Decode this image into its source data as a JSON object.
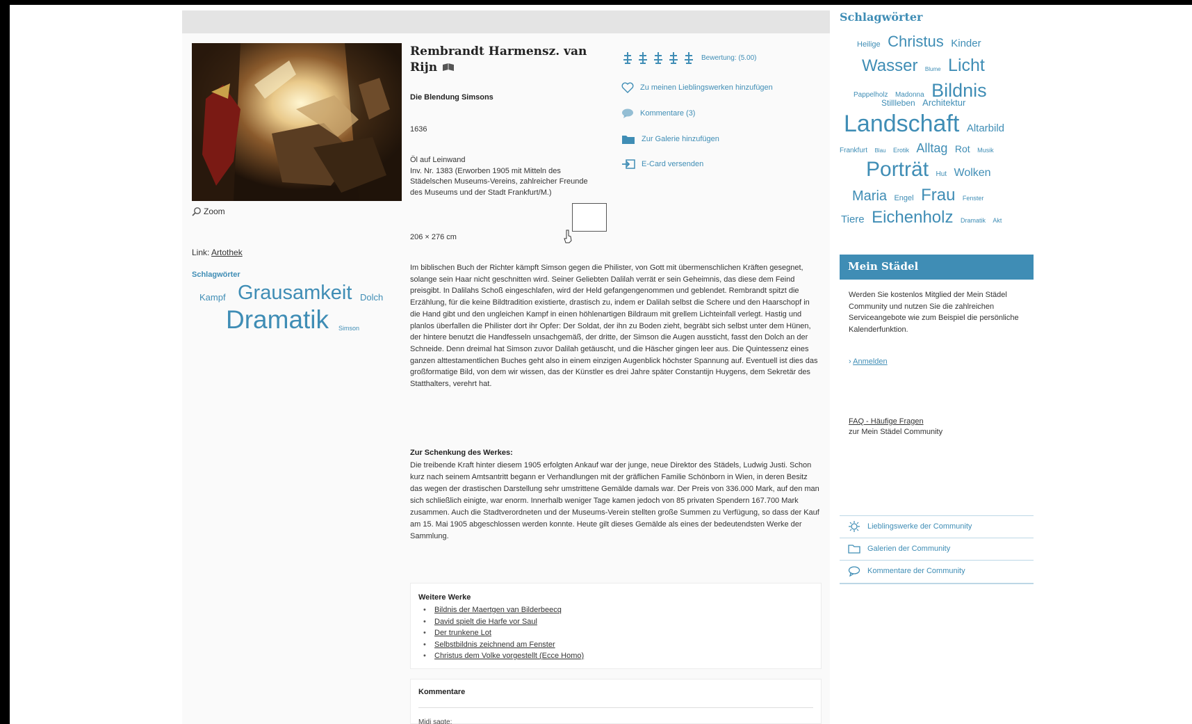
{
  "artwork": {
    "artist": "Rembrandt Harmensz. van Rijn",
    "title": "Die Blendung Simsons",
    "year": "1636",
    "medium": "Öl auf Leinwand",
    "inventory": "Inv. Nr. 1383 (Erworben 1905 mit Mitteln des Städelschen Museums-Vereins, zahlreicher Freunde des Museums und der Stadt Frankfurt/M.)",
    "dimensions": "206 × 276 cm",
    "zoom_label": "Zoom",
    "link_prefix": "Link:",
    "link_label": "Artothek"
  },
  "left_tags": {
    "title": "Schlagwörter",
    "items": [
      {
        "label": "Kampf"
      },
      {
        "label": "Grausamkeit"
      },
      {
        "label": "Dolch"
      },
      {
        "label": "Dramatik"
      },
      {
        "label": "Simson"
      }
    ]
  },
  "actions": {
    "rating_label": "Bewertung: (5.00)",
    "rating_value": 5,
    "favorite_label": "Zu meinen Lieblingswerken hinzufügen",
    "comments_label": "Kommentare (3)",
    "gallery_label": "Zur Galerie hinzufügen",
    "ecard_label": "E-Card versenden"
  },
  "description": "Im biblischen Buch der Richter kämpft Simson gegen die Philister, von Gott mit übermenschlichen Kräften gesegnet, solange sein Haar nicht geschnitten wird. Seiner Geliebten Dalilah verrät er sein Geheimnis, das diese dem Feind preisgibt. In Dalilahs Schoß eingeschlafen, wird der Held gefangengenommen und geblendet. Rembrandt spitzt die Erzählung, für die keine Bildtradition existierte, drastisch zu, indem er Dalilah selbst die Schere und den Haarschopf in die Hand gibt und den ungleichen Kampf in einen höhlenartigen Bildraum mit grellem Lichteinfall verlegt. Hastig und planlos überfallen die Philister dort ihr Opfer: Der Soldat, der ihn zu Boden zieht, begräbt sich selbst unter dem Hünen, der hintere benutzt die Handfesseln unsachgemäß, der dritte, der Simson die Augen aussticht, fasst den Dolch an der Schneide. Denn dreimal hat Simson zuvor Dalilah getäuscht, und die Häscher gingen leer aus. Die Quintessenz eines ganzen alttestamentlichen Buches geht also in einem einzigen Augenblick höchster Spannung auf. Eventuell ist dies das großformatige Bild, von dem wir wissen, das der Künstler es drei Jahre später Constantijn Huygens, dem Sekretär des Statthalters, verehrt hat.",
  "gift": {
    "heading": "Zur Schenkung des Werkes:",
    "text": "Die treibende Kraft hinter diesem 1905 erfolgten Ankauf war der junge, neue Direktor des Städels, Ludwig Justi. Schon kurz nach seinem Amtsantritt begann er Verhandlungen mit der gräflichen Familie Schönborn in Wien, in deren Besitz das wegen der drastischen Darstellung sehr umstrittene Gemälde damals war. Der Preis von 336.000 Mark, auf den man sich schließlich einigte, war enorm. Innerhalb weniger Tage kamen jedoch von 85 privaten Spendern 167.700 Mark zusammen. Auch die Stadtverordneten und der Museums-Verein stellten große Summen zu Verfügung, so dass der Kauf am 15. Mai 1905 abgeschlossen werden konnte. Heute gilt dieses Gemälde als eines der bedeutendsten Werke der Sammlung."
  },
  "more_works": {
    "title": "Weitere Werke",
    "items": [
      {
        "label": "Bildnis der Maertgen van Bilderbeecq"
      },
      {
        "label": "David spielt die Harfe vor Saul"
      },
      {
        "label": "Der trunkene Lot"
      },
      {
        "label": "Selbstbildnis zeichnend am Fenster"
      },
      {
        "label": "Christus dem Volke vorgestellt (Ecce Homo)"
      }
    ]
  },
  "comments": {
    "title": "Kommentare",
    "sub": "Midi sagte:"
  },
  "sidebar": {
    "title": "Schlagwörter",
    "tags": [
      {
        "label": "Heilige"
      },
      {
        "label": "Christus"
      },
      {
        "label": "Kinder"
      },
      {
        "label": "Wasser"
      },
      {
        "label": "Blume"
      },
      {
        "label": "Licht"
      },
      {
        "label": "Pappelholz"
      },
      {
        "label": "Madonna"
      },
      {
        "label": "Bildnis"
      },
      {
        "label": "Stillleben"
      },
      {
        "label": "Architektur"
      },
      {
        "label": "Landschaft"
      },
      {
        "label": "Altarbild"
      },
      {
        "label": "Frankfurt"
      },
      {
        "label": "Blau"
      },
      {
        "label": "Erotik"
      },
      {
        "label": "Alltag"
      },
      {
        "label": "Rot"
      },
      {
        "label": "Musik"
      },
      {
        "label": "Porträt"
      },
      {
        "label": "Hut"
      },
      {
        "label": "Wolken"
      },
      {
        "label": "Maria"
      },
      {
        "label": "Engel"
      },
      {
        "label": "Frau"
      },
      {
        "label": "Fenster"
      },
      {
        "label": "Tiere"
      },
      {
        "label": "Eichenholz"
      },
      {
        "label": "Dramatik"
      },
      {
        "label": "Akt"
      }
    ],
    "mein_title": "Mein Städel",
    "mein_text": "Werden Sie kostenlos Mitglied der Mein Städel Community und nutzen Sie die zahlreichen Serviceangebote wie zum Beispiel die persönliche Kalenderfunktion.",
    "login_label": "Anmelden",
    "faq_link": "FAQ - Häufige Fragen",
    "faq_sub": "zur Mein Städel Community",
    "community": [
      {
        "label": "Lieblingswerke der Community"
      },
      {
        "label": "Galerien der Community"
      },
      {
        "label": "Kommentare der Community"
      }
    ]
  },
  "colors": {
    "accent": "#3f8db5",
    "panel": "#fafafa",
    "header_bar": "#e4e4e4"
  }
}
